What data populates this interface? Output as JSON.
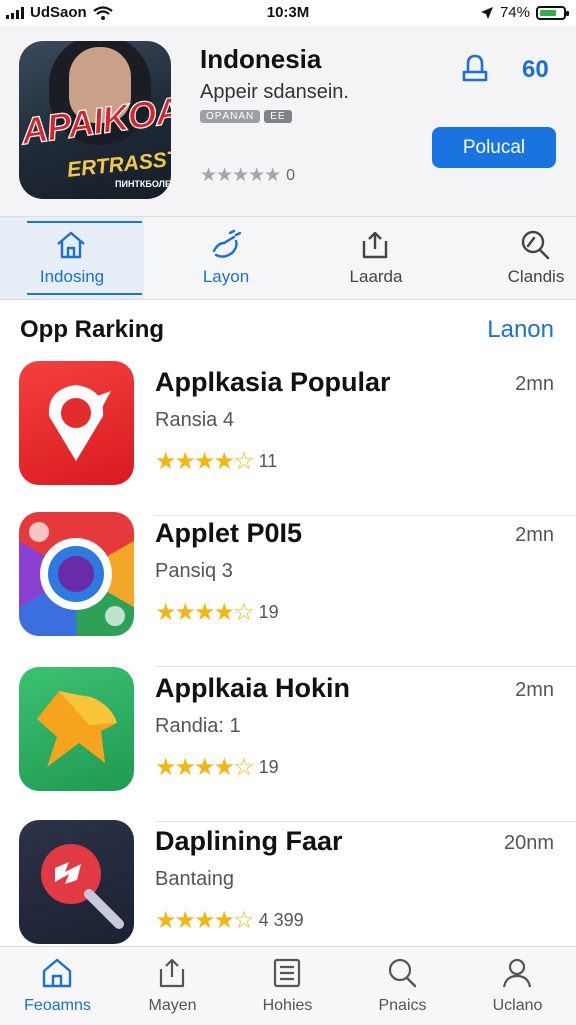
{
  "status_bar": {
    "carrier": "UdSaon",
    "time": "10:3M",
    "battery": "74%",
    "battery_level": 0.74,
    "icons": [
      "signal-icon",
      "wifi-icon",
      "location-icon",
      "battery-icon"
    ]
  },
  "app": {
    "name": "Indonesia",
    "subtitle": "Appeir sdansein.",
    "icon_text": "APAIKOAN",
    "icon_subtext": "ERTRASST",
    "icon_small_text": "ПИНТКБОЛЕК",
    "tags": [
      "OРANAN",
      "EE"
    ],
    "rating_stars": "★★★★★",
    "rating_count": "0",
    "share_label": "60",
    "get_button": "Polucal"
  },
  "tabs": [
    {
      "label": "Indosing",
      "icon": "house-icon",
      "active": true
    },
    {
      "label": "Layon",
      "icon": "hand-icon",
      "active": false
    },
    {
      "label": "Laarda",
      "icon": "share-box-icon",
      "active": false
    },
    {
      "label": "Clandis",
      "icon": "search-icon",
      "active": false
    }
  ],
  "section": {
    "title": "Opp Rarking",
    "link": "Lanon"
  },
  "apps": [
    {
      "name": "Applkasia Popular",
      "rank": "Ransia 4",
      "stars": "★★★★☆",
      "count": "11",
      "size": "2mn",
      "icon": "red-pin-icon"
    },
    {
      "name": "Applet P0I5",
      "rank": "Pansiq 3",
      "stars": "★★★★☆",
      "count": "19",
      "size": "2mn",
      "icon": "colorful-camera-icon"
    },
    {
      "name": "Applkaia Hokin",
      "rank": "Randia: 1",
      "stars": "★★★★☆",
      "count": "19",
      "size": "2mn",
      "icon": "orange-star-icon"
    },
    {
      "name": "Daplining Faar",
      "rank": "Bantaing",
      "stars": "★★★★☆",
      "count": "4 399",
      "size": "20nm",
      "icon": "red-play-icon"
    }
  ],
  "bottom_nav": [
    {
      "label": "Feoamns",
      "icon": "home-icon",
      "active": true
    },
    {
      "label": "Mayen",
      "icon": "share-icon",
      "active": false
    },
    {
      "label": "Hohies",
      "icon": "list-icon",
      "active": false
    },
    {
      "label": "Pnaics",
      "icon": "search-icon",
      "active": false
    },
    {
      "label": "Uclano",
      "icon": "person-icon",
      "active": false
    }
  ],
  "colors": {
    "accent": "#1a74e0",
    "star": "#f3b714",
    "header_bg": "#f4f4f6"
  }
}
